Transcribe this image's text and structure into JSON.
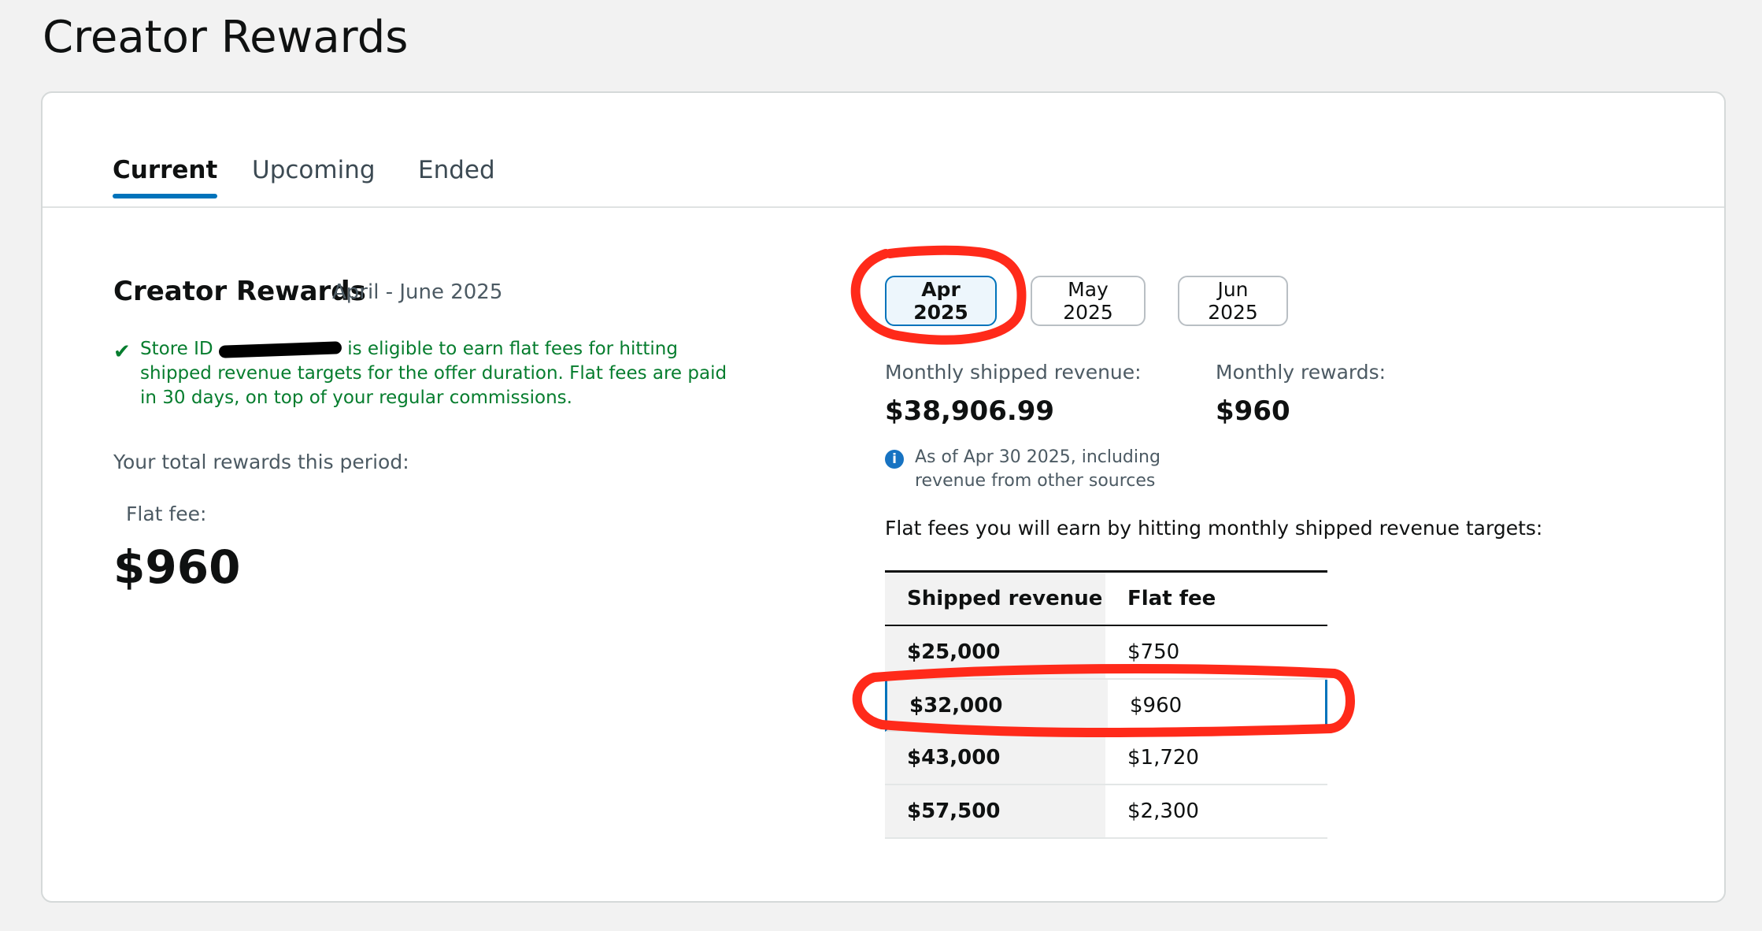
{
  "page": {
    "title": "Creator Rewards"
  },
  "tabs": [
    {
      "label": "Current",
      "active": true
    },
    {
      "label": "Upcoming",
      "active": false
    },
    {
      "label": "Ended",
      "active": false
    }
  ],
  "summary": {
    "title": "Creator Rewards",
    "date_range": "April - June 2025",
    "eligibility_prefix": "Store ID",
    "eligibility_text": "is eligible to earn flat fees for hitting shipped revenue targets for the offer duration. Flat fees are paid in 30 days, on top of your regular commissions.",
    "total_label": "Your total rewards this period:",
    "flat_fee_label": "Flat fee:",
    "flat_fee_value": "$960"
  },
  "months": [
    {
      "label": "Apr 2025",
      "selected": true
    },
    {
      "label": "May 2025",
      "selected": false
    },
    {
      "label": "Jun 2025",
      "selected": false
    }
  ],
  "stats": {
    "revenue_label": "Monthly shipped revenue:",
    "revenue_value": "$38,906.99",
    "rewards_label": "Monthly rewards:",
    "rewards_value": "$960",
    "info_note": "As of Apr 30 2025, including revenue from other sources"
  },
  "targets": {
    "intro": "Flat fees you will earn by hitting monthly shipped revenue targets:",
    "columns": [
      "Shipped revenue",
      "Flat fee"
    ],
    "rows": [
      [
        "$25,000",
        "$750"
      ],
      [
        "$32,000",
        "$960"
      ],
      [
        "$43,000",
        "$1,720"
      ],
      [
        "$57,500",
        "$2,300"
      ]
    ]
  },
  "colors": {
    "accent": "#0073bb",
    "success": "#067d2e",
    "annotation": "#ff2a1a"
  }
}
